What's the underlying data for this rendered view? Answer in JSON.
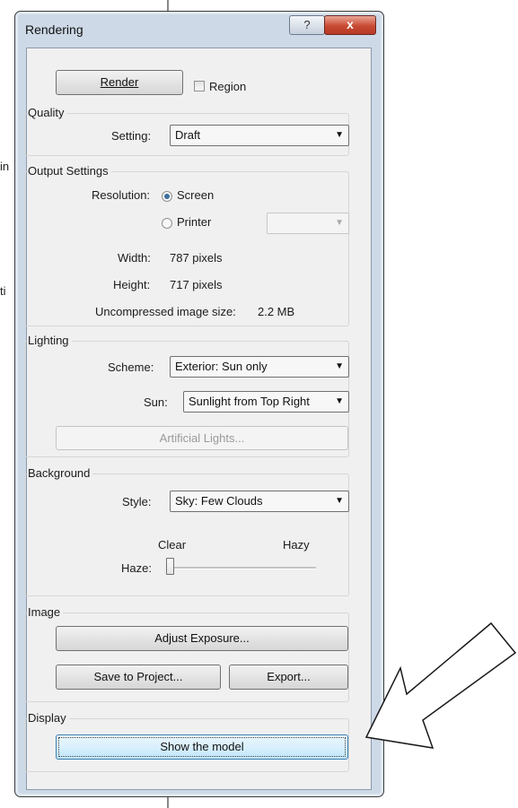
{
  "background": {
    "text_in": "in",
    "text_ti": "ti"
  },
  "window": {
    "title": "Rendering",
    "help_label": "?",
    "close_label": "x"
  },
  "render": {
    "button_label": "Render",
    "region_label": "Region",
    "region_checked": false
  },
  "quality": {
    "group_label": "Quality",
    "setting_label": "Setting:",
    "setting_value": "Draft"
  },
  "output": {
    "group_label": "Output Settings",
    "resolution_label": "Resolution:",
    "screen_label": "Screen",
    "printer_label": "Printer",
    "selected": "Screen",
    "printer_dpi_value": "",
    "width_label": "Width:",
    "width_value": "787 pixels",
    "height_label": "Height:",
    "height_value": "717 pixels",
    "size_label": "Uncompressed image size:",
    "size_value": "2.2 MB"
  },
  "lighting": {
    "group_label": "Lighting",
    "scheme_label": "Scheme:",
    "scheme_value": "Exterior: Sun only",
    "sun_label": "Sun:",
    "sun_value": "Sunlight from Top Right",
    "artificial_label": "Artificial Lights..."
  },
  "background_group": {
    "group_label": "Background",
    "style_label": "Style:",
    "style_value": "Sky: Few Clouds",
    "clear_label": "Clear",
    "hazy_label": "Hazy",
    "haze_label": "Haze:",
    "haze_level": 0
  },
  "image": {
    "group_label": "Image",
    "adjust_label": "Adjust Exposure...",
    "save_label": "Save to Project...",
    "export_label": "Export..."
  },
  "display": {
    "group_label": "Display",
    "show_model_label": "Show the model"
  },
  "icons": {
    "dropdown": "chevron-down-icon",
    "callout": "arrow-icon"
  },
  "colors": {
    "frame": "#cdd9e7",
    "close": "#c84a33",
    "client": "#f0f0f0"
  }
}
